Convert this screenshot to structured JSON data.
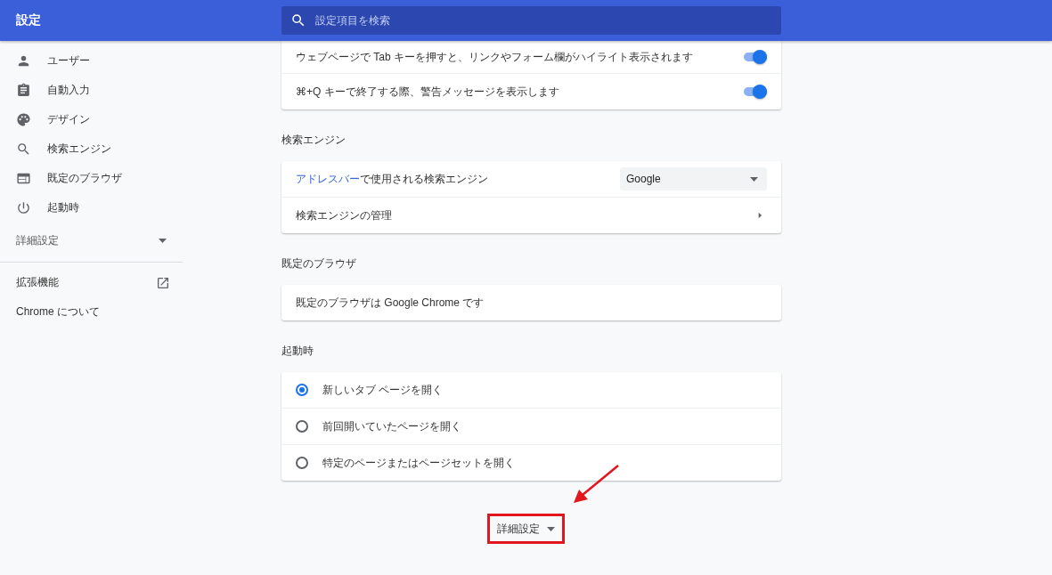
{
  "header": {
    "title": "設定",
    "search": {
      "placeholder": "設定項目を検索"
    }
  },
  "sidebar": {
    "items": [
      {
        "label": "ユーザー"
      },
      {
        "label": "自動入力"
      },
      {
        "label": "デザイン"
      },
      {
        "label": "検索エンジン"
      },
      {
        "label": "既定のブラウザ"
      },
      {
        "label": "起動時"
      }
    ],
    "advanced": {
      "label": "詳細設定",
      "expanded": false
    },
    "links": [
      {
        "label": "拡張機能",
        "kind": "external"
      },
      {
        "label": "Chrome について",
        "kind": "plain"
      }
    ]
  },
  "sections": [
    {
      "rows": [
        {
          "kind": "toggle",
          "label": "ウェブページで Tab キーを押すと、リンクやフォーム欄がハイライト表示されます",
          "on": true
        },
        {
          "kind": "toggle",
          "label": "⌘+Q キーで終了する際、警告メッセージを表示します",
          "on": true
        }
      ]
    },
    {
      "title": "検索エンジン",
      "rows": [
        {
          "kind": "select",
          "link": "アドレスバー",
          "label": "で使用される検索エンジン",
          "value": "Google"
        },
        {
          "kind": "arrow",
          "label": "検索エンジンの管理"
        }
      ]
    },
    {
      "title": "既定のブラウザ",
      "rows": [
        {
          "kind": "text",
          "label": "既定のブラウザは Google Chrome です"
        }
      ]
    },
    {
      "title": "起動時",
      "rows": [
        {
          "kind": "radio",
          "label": "新しいタブ ページを開く",
          "selected": true
        },
        {
          "kind": "radio",
          "label": "前回開いていたページを開く",
          "selected": false
        },
        {
          "kind": "radio",
          "label": "特定のページまたはページセットを開く",
          "selected": false
        }
      ]
    }
  ],
  "advanced_button": {
    "label": "詳細設定",
    "expanded": false
  }
}
